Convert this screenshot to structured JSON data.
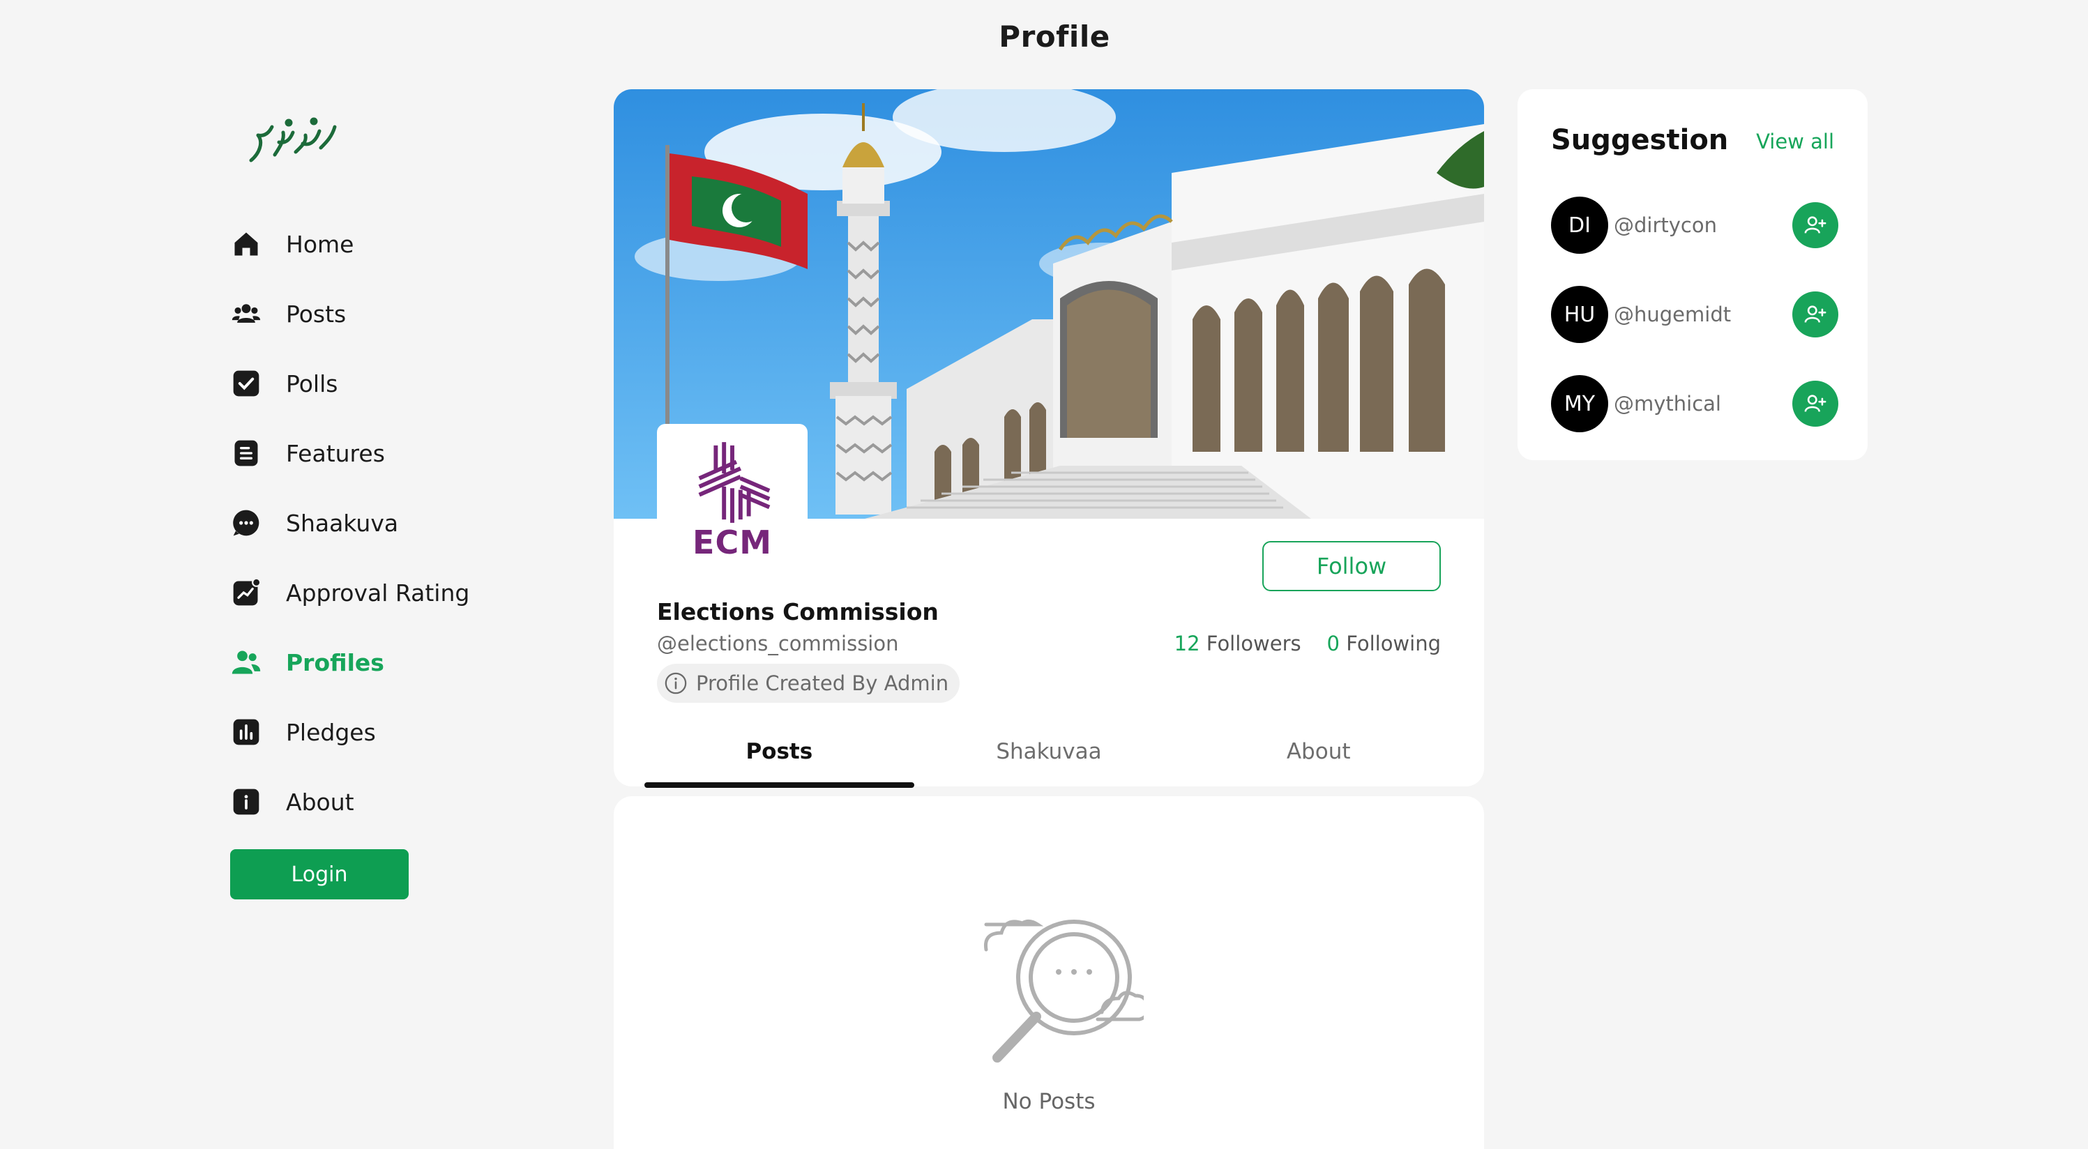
{
  "page": {
    "title": "Profile"
  },
  "sidebar": {
    "items": [
      {
        "label": "Home",
        "icon": "home-icon",
        "active": false
      },
      {
        "label": "Posts",
        "icon": "users-icon",
        "active": false
      },
      {
        "label": "Polls",
        "icon": "checkbox-icon",
        "active": false
      },
      {
        "label": "Features",
        "icon": "document-icon",
        "active": false
      },
      {
        "label": "Shaakuva",
        "icon": "chat-bubble-icon",
        "active": false
      },
      {
        "label": "Approval Rating",
        "icon": "trend-chart-icon",
        "active": false
      },
      {
        "label": "Profiles",
        "icon": "profiles-icon",
        "active": true
      },
      {
        "label": "Pledges",
        "icon": "bar-chart-icon",
        "active": false
      },
      {
        "label": "About",
        "icon": "info-icon",
        "active": false
      }
    ],
    "login_label": "Login"
  },
  "profile": {
    "avatar_text": "ECM",
    "name": "Elections Commission",
    "handle": "@elections_commission",
    "followers_count": "12",
    "followers_label": "Followers",
    "following_count": "0",
    "following_label": "Following",
    "follow_label": "Follow",
    "badge": "Profile Created By Admin",
    "tabs": [
      "Posts",
      "Shakuvaa",
      "About"
    ],
    "active_tab": "Posts",
    "empty_text": "No Posts"
  },
  "suggestions": {
    "title": "Suggestion",
    "view_all": "View all",
    "users": [
      {
        "initials": "DI",
        "handle": "@dirtycon"
      },
      {
        "initials": "HU",
        "handle": "@hugemidt"
      },
      {
        "initials": "MY",
        "handle": "@mythical"
      }
    ]
  },
  "colors": {
    "accent": "#17a55a",
    "ecm_purple": "#76267a",
    "background": "#f5f5f5"
  }
}
